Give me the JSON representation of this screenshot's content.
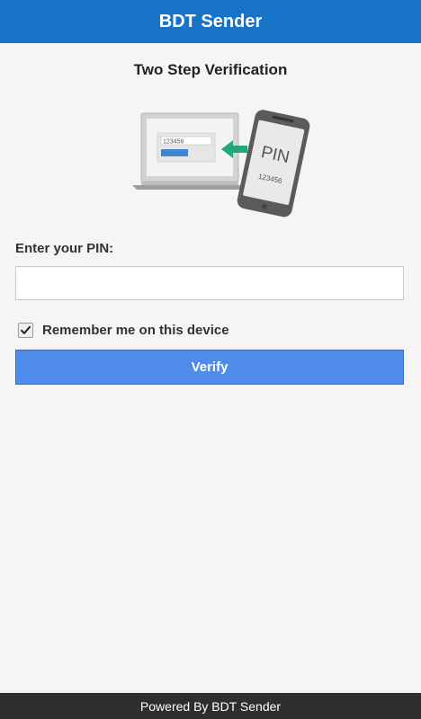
{
  "app": {
    "title": "BDT Sender"
  },
  "main": {
    "heading": "Two Step Verification",
    "illustration": {
      "laptop_code": "123456",
      "phone_pin_text": "PIN",
      "phone_code": "123456"
    },
    "pin_label": "Enter your PIN:",
    "pin_input": {
      "value": "",
      "placeholder": ""
    },
    "remember": {
      "label": "Remember me on this device",
      "checked": true
    },
    "verify_label": "Verify"
  },
  "footer": {
    "text": "Powered By BDT Sender"
  },
  "colors": {
    "header_bg": "#1673c7",
    "button_bg": "#4f8bea",
    "footer_bg": "#2e2e2e",
    "page_bg": "#f5f5f5",
    "arrow": "#21a77a"
  }
}
